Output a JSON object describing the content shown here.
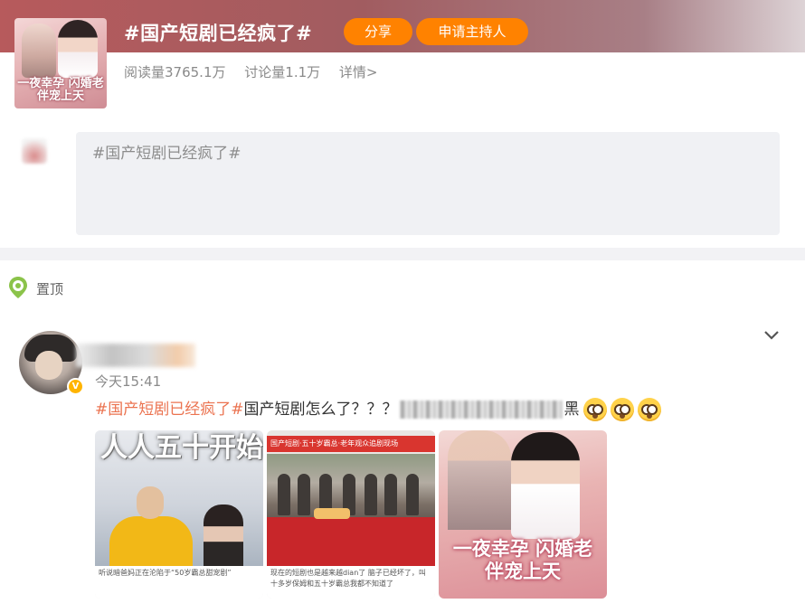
{
  "topic": {
    "title": "#国产短剧已经疯了#",
    "cover_text": "一夜幸孕 闪婚老伴宠上天",
    "share_label": "分享",
    "host_label": "申请主持人",
    "stats": {
      "reads": "阅读量3765.1万",
      "discussions": "讨论量1.1万",
      "detail_link": "详情>"
    }
  },
  "compose": {
    "value": "#国产短剧已经疯了#"
  },
  "pinned": {
    "label": "置顶"
  },
  "post": {
    "time": "今天15:41",
    "hashtag": "#国产短剧已经疯了#",
    "text_before": "国产短剧怎么了？？？",
    "text_after": "黑",
    "emoji_count": 3,
    "images": [
      {
        "headline": "人人五十开始闪婚",
        "caption": "听说暗爸妈正在沦陷于“50岁霸总甜宠剧”"
      },
      {
        "banner": "国产短剧·五十岁霸总·老年观众追剧现场",
        "caption": "现在的短剧也是越来越dian了 脑子已经坏了，叫十多岁保姆和五十岁霸总我都不知道了"
      },
      {
        "title": "一夜幸孕 闪婚老伴宠上天"
      }
    ]
  },
  "colors": {
    "accent": "#ff8200",
    "hashtag": "#eb7350",
    "header_start": "#b75a5c",
    "pin_green": "#8bc34a",
    "verify": "#ffb400"
  },
  "icons": {
    "pin": "location-pin-icon",
    "chevron": "chevron-down-icon",
    "verify": "verified-badge-icon",
    "emoji": "dizzy-eyes-emoji-icon"
  }
}
